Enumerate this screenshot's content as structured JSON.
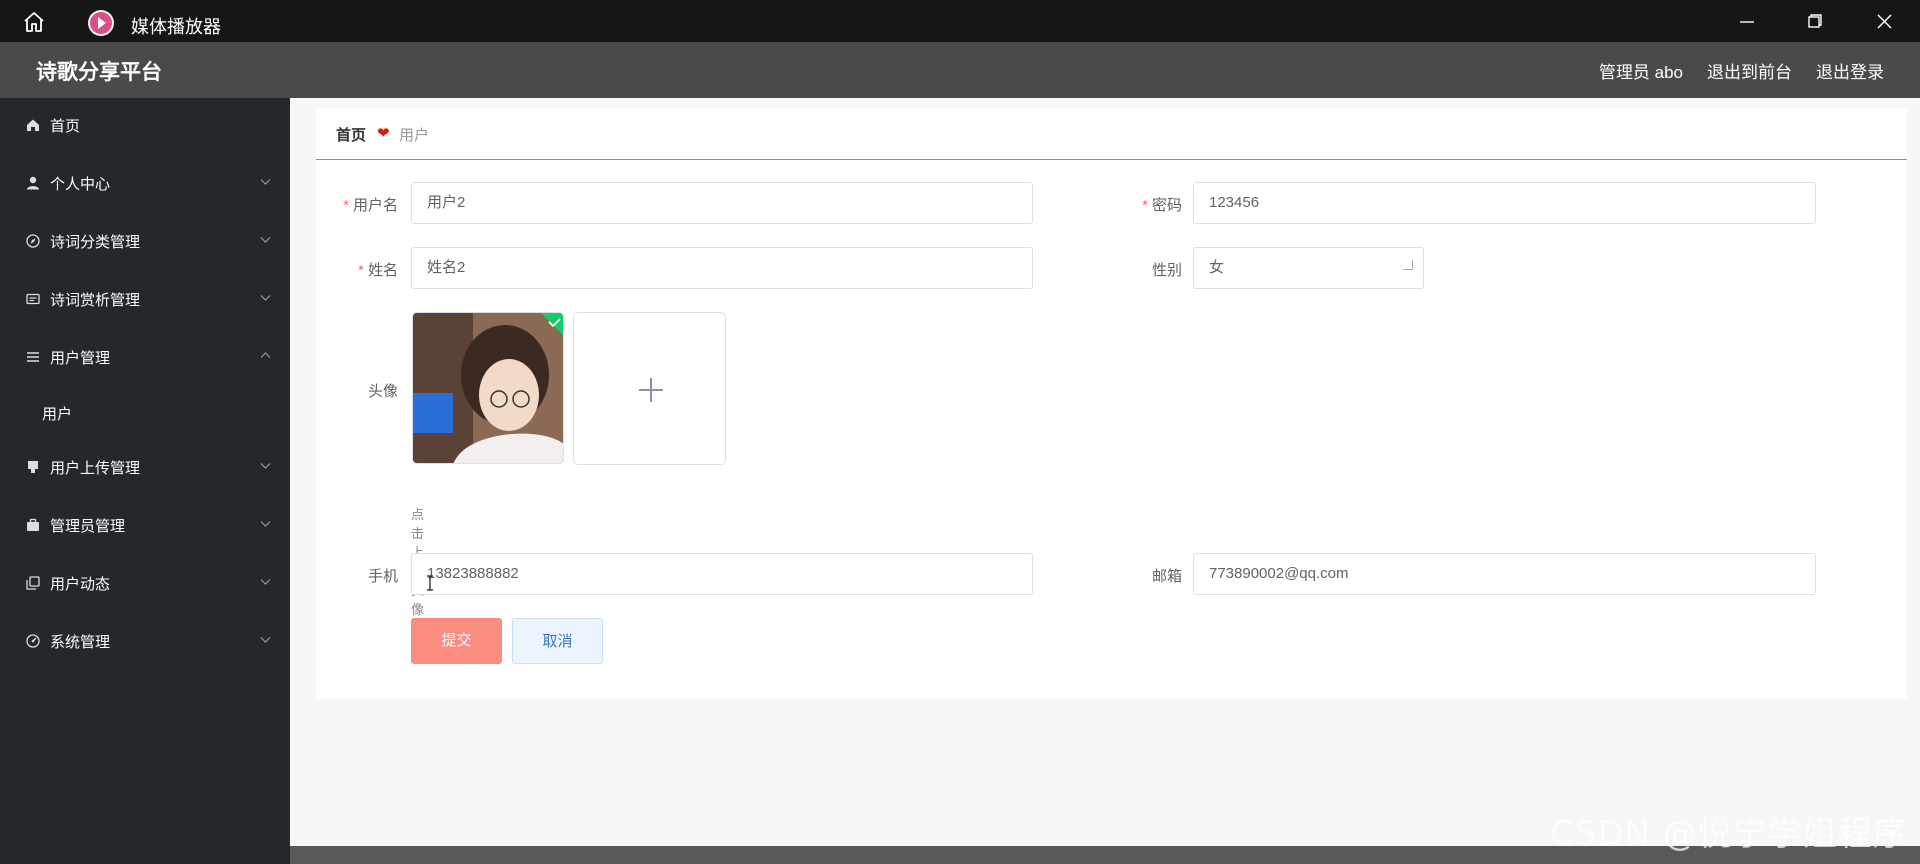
{
  "window": {
    "title": "媒体播放器"
  },
  "header": {
    "brand": "诗歌分享平台",
    "admin_label": "管理员 abo",
    "to_front_label": "退出到前台",
    "logout_label": "退出登录"
  },
  "sidebar": {
    "items": [
      {
        "label": "首页",
        "icon": "home-icon"
      },
      {
        "label": "个人中心",
        "icon": "user-icon"
      },
      {
        "label": "诗词分类管理",
        "icon": "compass-icon"
      },
      {
        "label": "诗词赏析管理",
        "icon": "card-icon"
      },
      {
        "label": "用户管理",
        "icon": "list-icon"
      },
      {
        "label": "用户",
        "icon": ""
      },
      {
        "label": "用户上传管理",
        "icon": "stamp-icon"
      },
      {
        "label": "管理员管理",
        "icon": "briefcase-icon"
      },
      {
        "label": "用户动态",
        "icon": "copy-icon"
      },
      {
        "label": "系统管理",
        "icon": "dashboard-icon"
      }
    ]
  },
  "breadcrumb": {
    "home": "首页",
    "current": "用户"
  },
  "form": {
    "username_label": "用户名",
    "username_value": "用户2",
    "password_label": "密码",
    "password_value": "123456",
    "name_label": "姓名",
    "name_value": "姓名2",
    "gender_label": "性别",
    "gender_value": "女",
    "avatar_label": "头像",
    "avatar_tip": "点击上传头像",
    "phone_label": "手机",
    "phone_value": "13823888882",
    "email_label": "邮箱",
    "email_value": "773890002@qq.com",
    "submit_label": "提交",
    "cancel_label": "取消"
  },
  "watermark": "CSDN @悦宁学姐程序",
  "colors": {
    "sidebar_bg": "#24272b",
    "header_bg": "#4a4a4a",
    "submit_bg": "#fb8c80",
    "required": "#f56c6c"
  }
}
